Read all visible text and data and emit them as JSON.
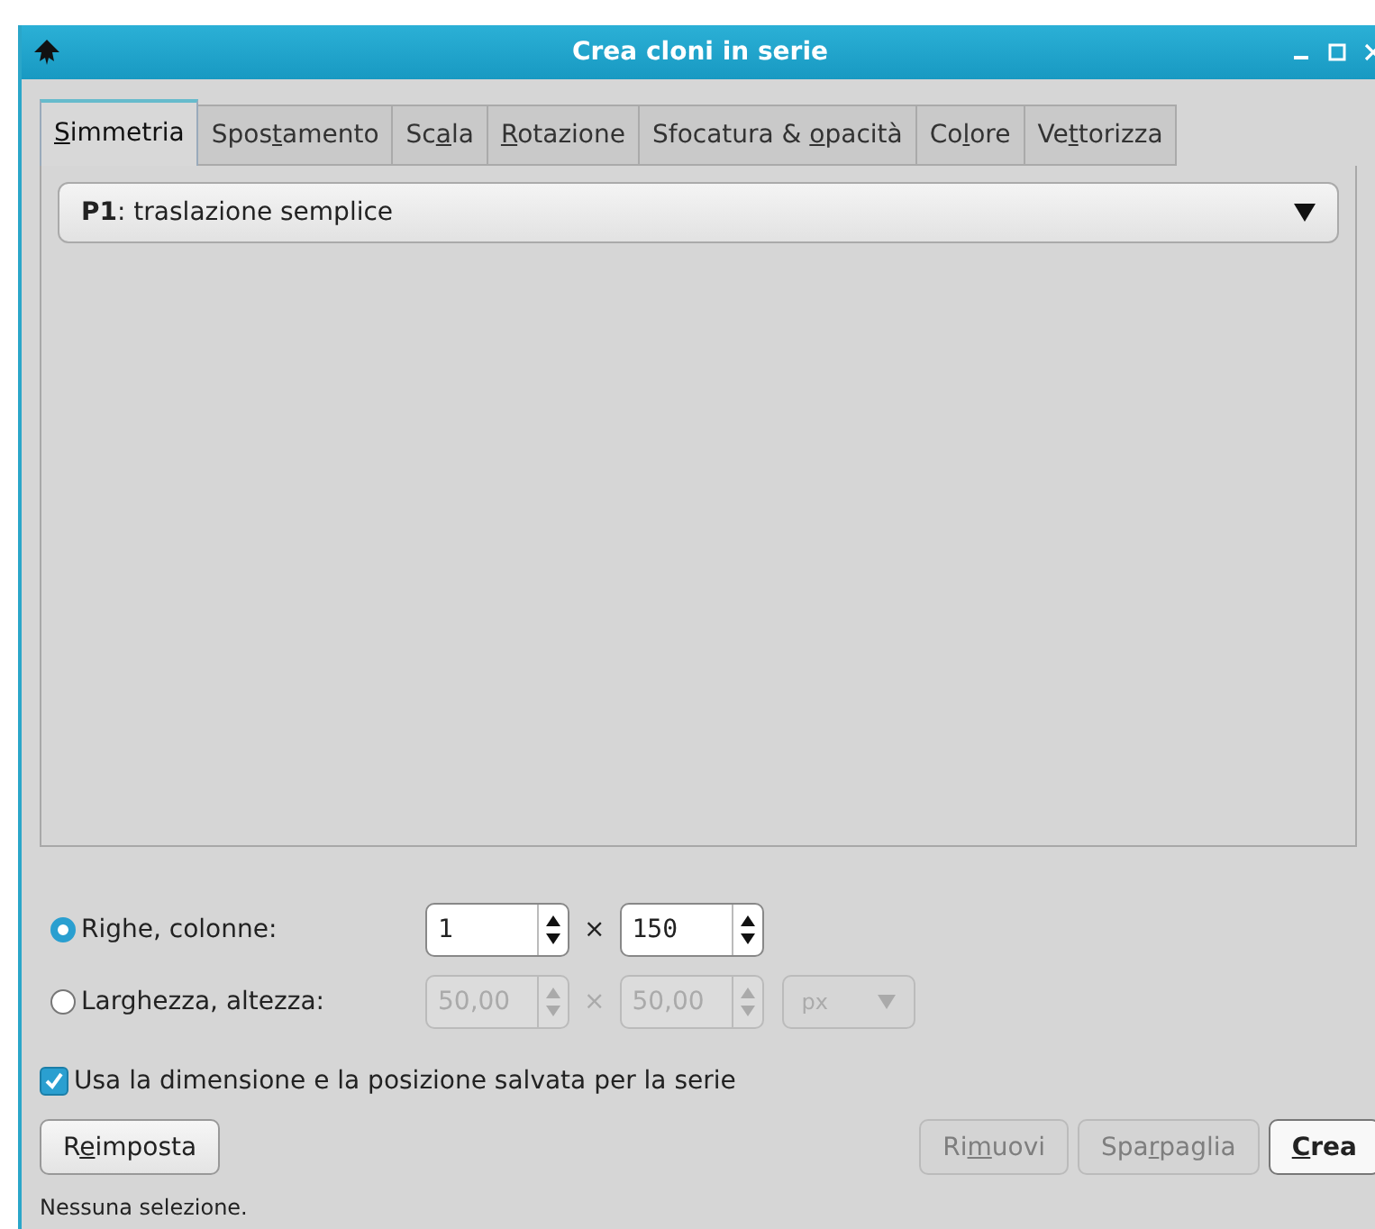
{
  "window": {
    "title": "Crea cloni in serie"
  },
  "tabs": [
    {
      "key": "S",
      "post": "immetria",
      "selected": true
    },
    {
      "pre": "Spos",
      "key": "t",
      "post": "amento",
      "selected": false
    },
    {
      "pre": "Sc",
      "key": "a",
      "post": "la",
      "selected": false
    },
    {
      "key": "R",
      "post": "otazione",
      "selected": false
    },
    {
      "pre": "Sfocatura & ",
      "key": "o",
      "post": "pacità",
      "selected": false
    },
    {
      "pre": "Co",
      "key": "l",
      "post": "ore",
      "selected": false
    },
    {
      "pre": "Ve",
      "key": "t",
      "post": "torizza",
      "selected": false
    }
  ],
  "symmetry_dropdown": {
    "value": "**P1**: traslazione semplice"
  },
  "size_options": [
    {
      "label": "Righe, colonne:",
      "selected": true,
      "fields": [
        {
          "value": "1",
          "disabled": false
        },
        {
          "value": "150",
          "disabled": false
        }
      ],
      "separator": "×"
    },
    {
      "label": "Larghezza, altezza:",
      "selected": false,
      "fields": [
        {
          "value": "50,00",
          "disabled": true
        },
        {
          "value": "50,00",
          "disabled": true
        }
      ],
      "separator": "×",
      "unit": {
        "value": "px",
        "disabled": true
      }
    }
  ],
  "saved_size_checkbox": {
    "label": "Usa la dimensione e la posizione salvata per la serie",
    "checked": true
  },
  "buttons": [
    {
      "pre": "R",
      "key": "e",
      "post": "imposta",
      "disabled": false,
      "default": false
    },
    {
      "pre": "Ri",
      "key": "m",
      "post": "uovi",
      "disabled": true,
      "default": false
    },
    {
      "pre": "Spa",
      "key": "r",
      "post": "paglia",
      "disabled": true,
      "default": false
    },
    {
      "key": "C",
      "post": "rea",
      "disabled": false,
      "default": true
    }
  ],
  "status_bar": "Nessuna selezione."
}
